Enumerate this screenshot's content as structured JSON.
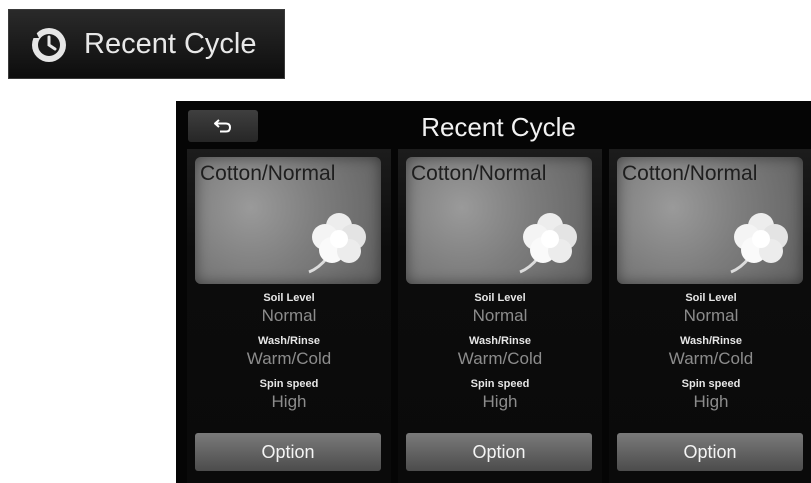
{
  "header_button": {
    "icon": "recent-clock-icon",
    "label": "Recent Cycle"
  },
  "screen": {
    "back_icon": "back-arrow-icon",
    "title": "Recent Cycle",
    "cards": [
      {
        "cycle": "Cotton/Normal",
        "image_icon": "cotton-icon",
        "soil_label": "Soil Level",
        "soil_value": "Normal",
        "wash_label": "Wash/Rinse",
        "wash_value": "Warm/Cold",
        "spin_label": "Spin speed",
        "spin_value": "High",
        "option": "Option"
      },
      {
        "cycle": "Cotton/Normal",
        "image_icon": "cotton-icon",
        "soil_label": "Soil Level",
        "soil_value": "Normal",
        "wash_label": "Wash/Rinse",
        "wash_value": "Warm/Cold",
        "spin_label": "Spin speed",
        "spin_value": "High",
        "option": "Option"
      },
      {
        "cycle": "Cotton/Normal",
        "image_icon": "cotton-icon",
        "soil_label": "Soil Level",
        "soil_value": "Normal",
        "wash_label": "Wash/Rinse",
        "wash_value": "Warm/Cold",
        "spin_label": "Spin speed",
        "spin_value": "High",
        "option": "Option"
      }
    ]
  }
}
